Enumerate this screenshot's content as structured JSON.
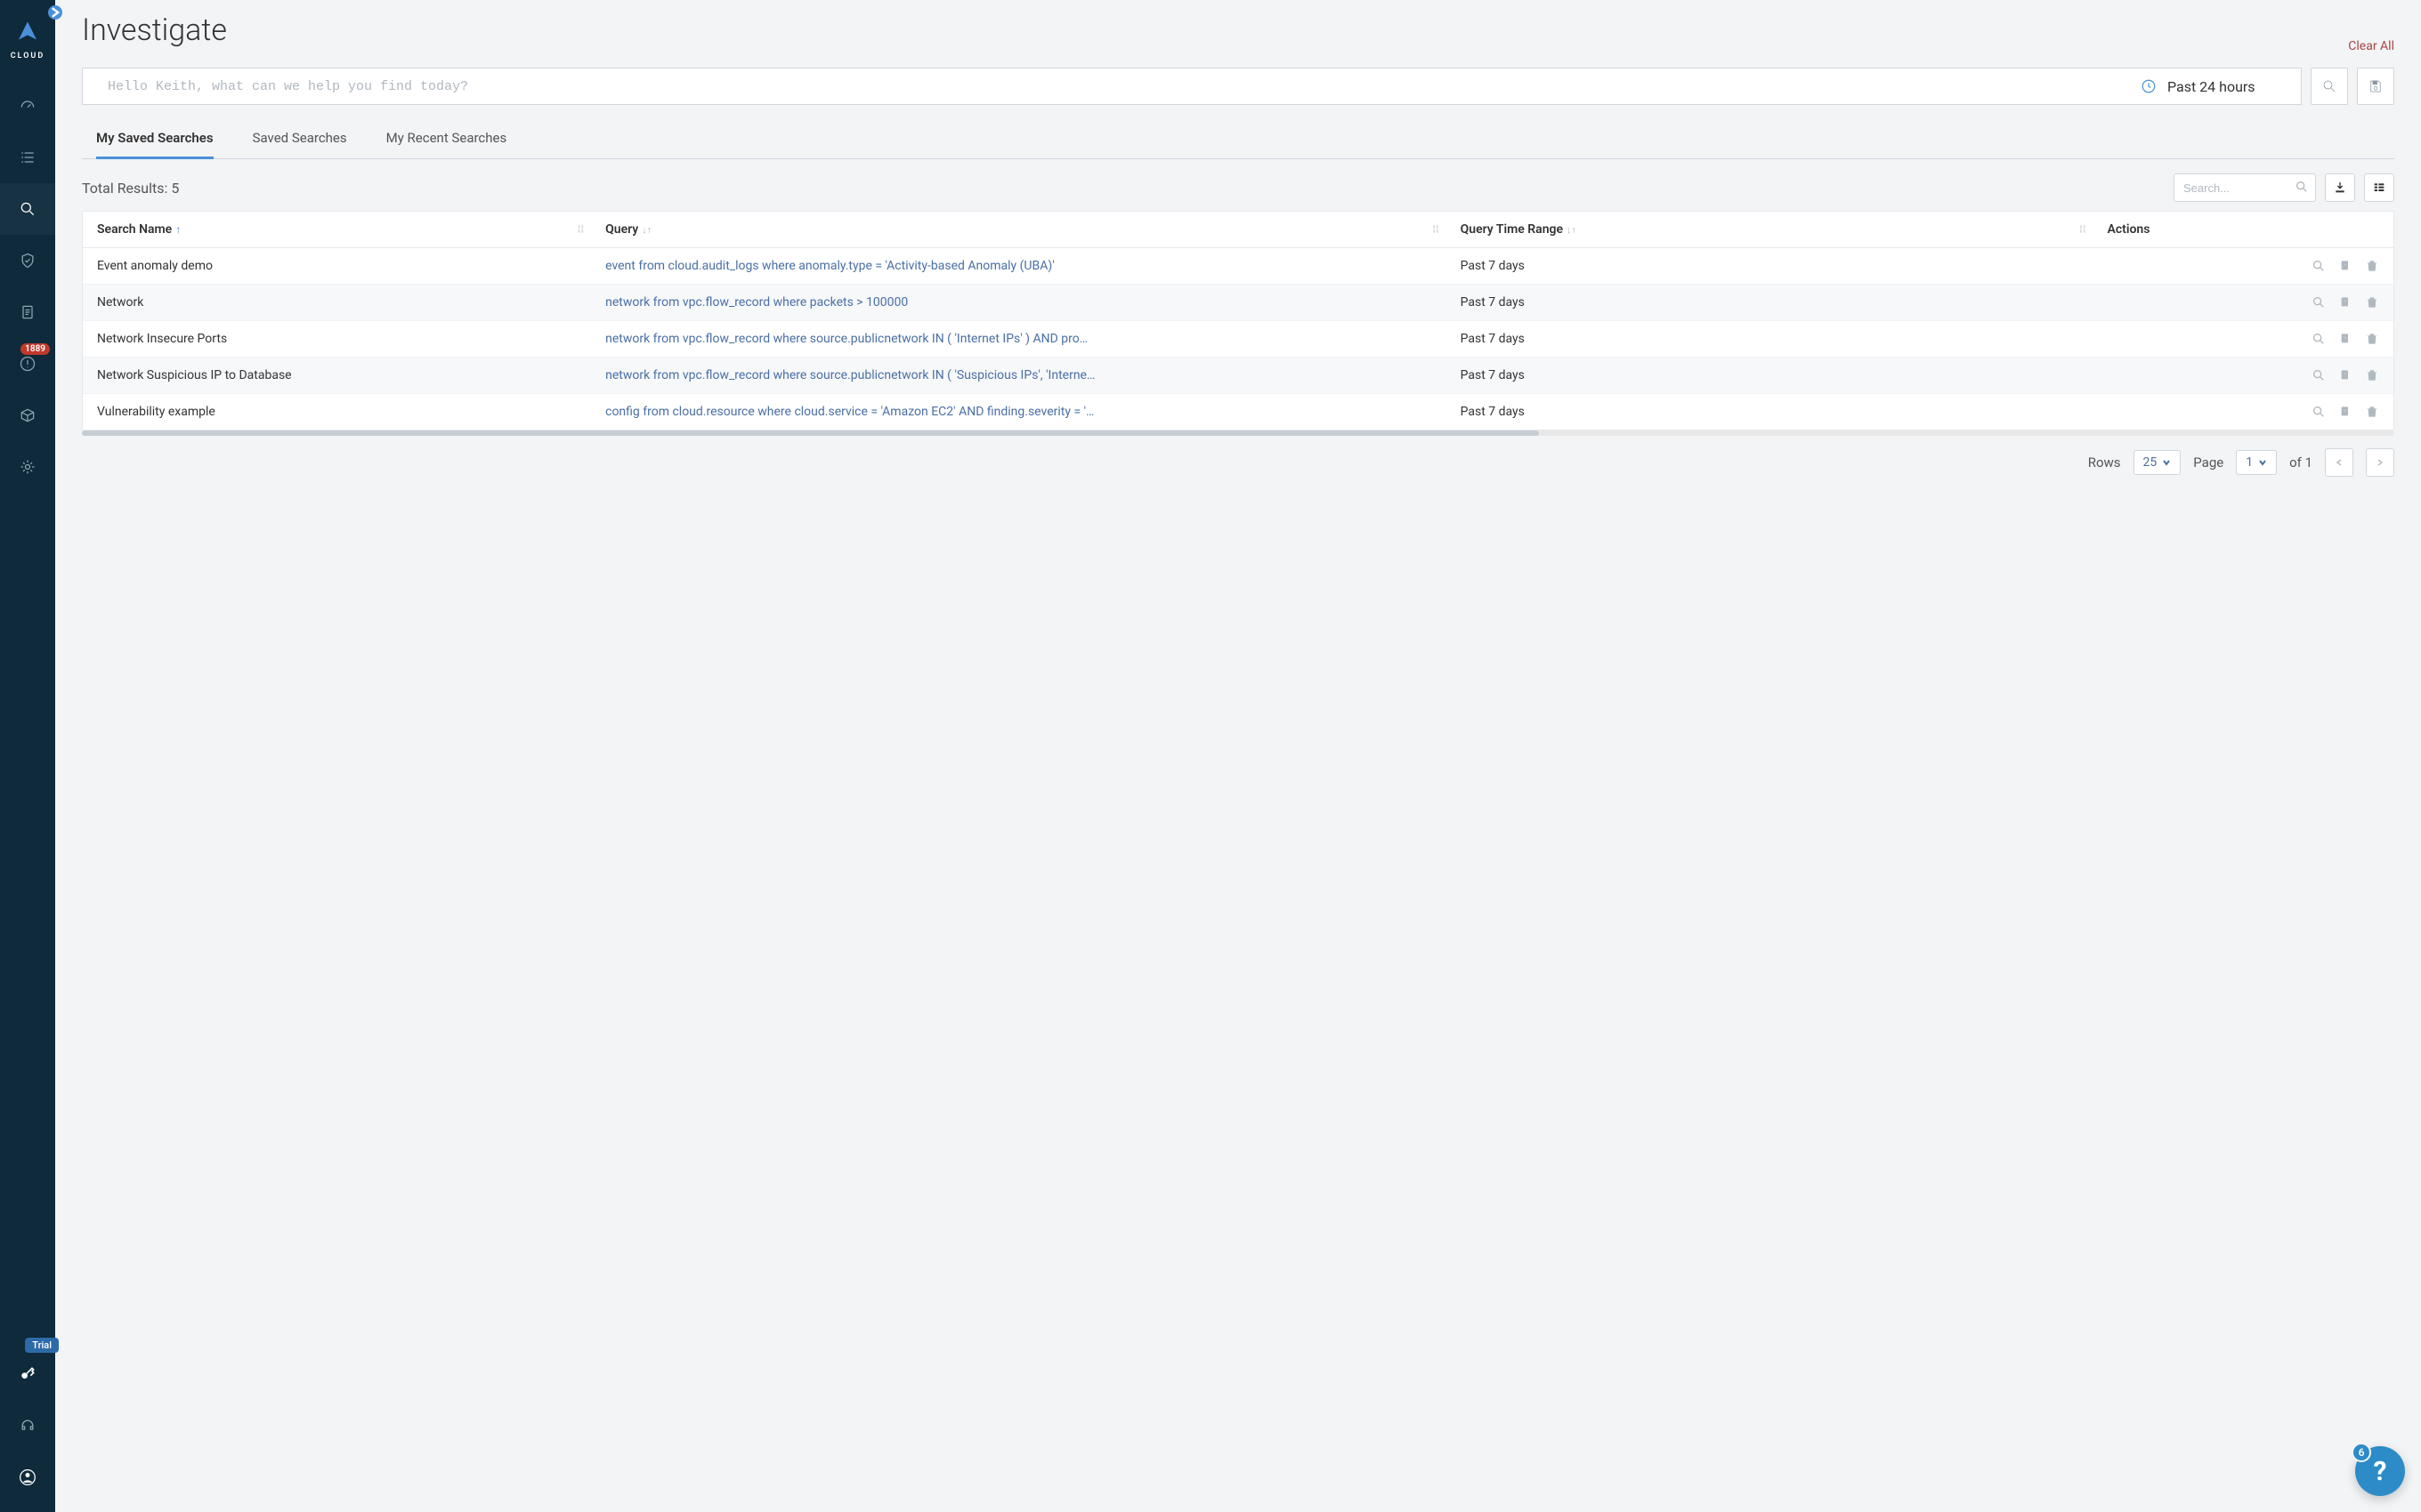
{
  "sidebar": {
    "logo_text": "CLOUD",
    "alerts_badge": "1889",
    "trial_pill": "Trial"
  },
  "header": {
    "title": "Investigate",
    "clear_all": "Clear All"
  },
  "search": {
    "placeholder": "Hello Keith, what can we help you find today?",
    "timerange": "Past 24 hours"
  },
  "tabs": [
    {
      "label": "My Saved Searches",
      "active": true
    },
    {
      "label": "Saved Searches",
      "active": false
    },
    {
      "label": "My Recent Searches",
      "active": false
    }
  ],
  "results": {
    "total_label": "Total Results: 5",
    "filter_placeholder": "Search..."
  },
  "table": {
    "columns": [
      "Search Name",
      "Query",
      "Query Time Range",
      "Actions"
    ],
    "rows": [
      {
        "name": "Event anomaly demo",
        "query": "event from cloud.audit_logs where anomaly.type = 'Activity-based Anomaly (UBA)'",
        "range": "Past 7 days"
      },
      {
        "name": "Network",
        "query": "network from vpc.flow_record where packets > 100000",
        "range": "Past 7 days"
      },
      {
        "name": "Network Insecure Ports",
        "query": "network from vpc.flow_record where source.publicnetwork IN ( 'Internet IPs' ) AND pro…",
        "range": "Past 7 days"
      },
      {
        "name": "Network Suspicious IP to Database",
        "query": "network from vpc.flow_record where source.publicnetwork IN ( 'Suspicious IPs', 'Interne…",
        "range": "Past 7 days"
      },
      {
        "name": "Vulnerability example",
        "query": "config from cloud.resource where cloud.service = 'Amazon EC2' AND finding.severity = '…",
        "range": "Past 7 days"
      }
    ]
  },
  "pager": {
    "rows_label": "Rows",
    "rows_value": "25",
    "page_label": "Page",
    "page_value": "1",
    "of_label": "of 1"
  },
  "help": {
    "badge": "6"
  }
}
